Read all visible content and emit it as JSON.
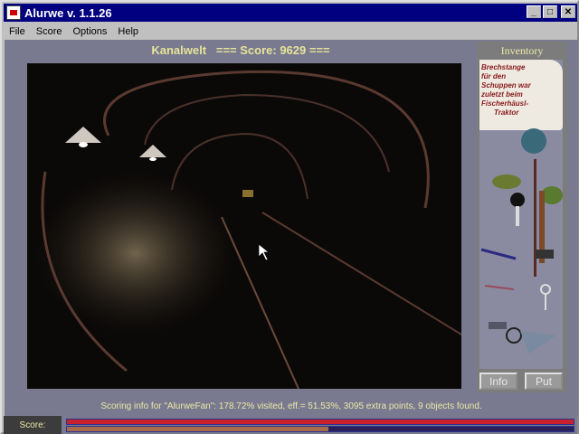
{
  "window": {
    "title": "Alurwe v. 1.1.26",
    "minimize": "_",
    "maximize": "□",
    "close": "✕"
  },
  "menu": [
    "File",
    "Score",
    "Options",
    "Help"
  ],
  "heading": "Kanalwelt   === Score: 9629 ===",
  "inventory": {
    "title": "Inventory",
    "note_text": [
      "Brechstange",
      "für den",
      "Schuppen war",
      "zuletzt beim",
      "Fischerhäusl-",
      "Traktor"
    ],
    "items": [
      "note",
      "plant",
      "car-key",
      "hammer",
      "crowbar",
      "cotter-pin",
      "old-key",
      "key-ring"
    ],
    "info_label": "Info",
    "put_label": "Put"
  },
  "scoring_info": "Scoring info for \"AlurweFan\": 178.72% visited, eff.= 51.53%, 3095 extra points, 9 objects found.",
  "status": {
    "label": "Score:",
    "visited_fraction": 1.0,
    "efficiency_fraction": 0.5153,
    "visited_color": "#c8202c",
    "efficiency_color": "#a86a48"
  }
}
